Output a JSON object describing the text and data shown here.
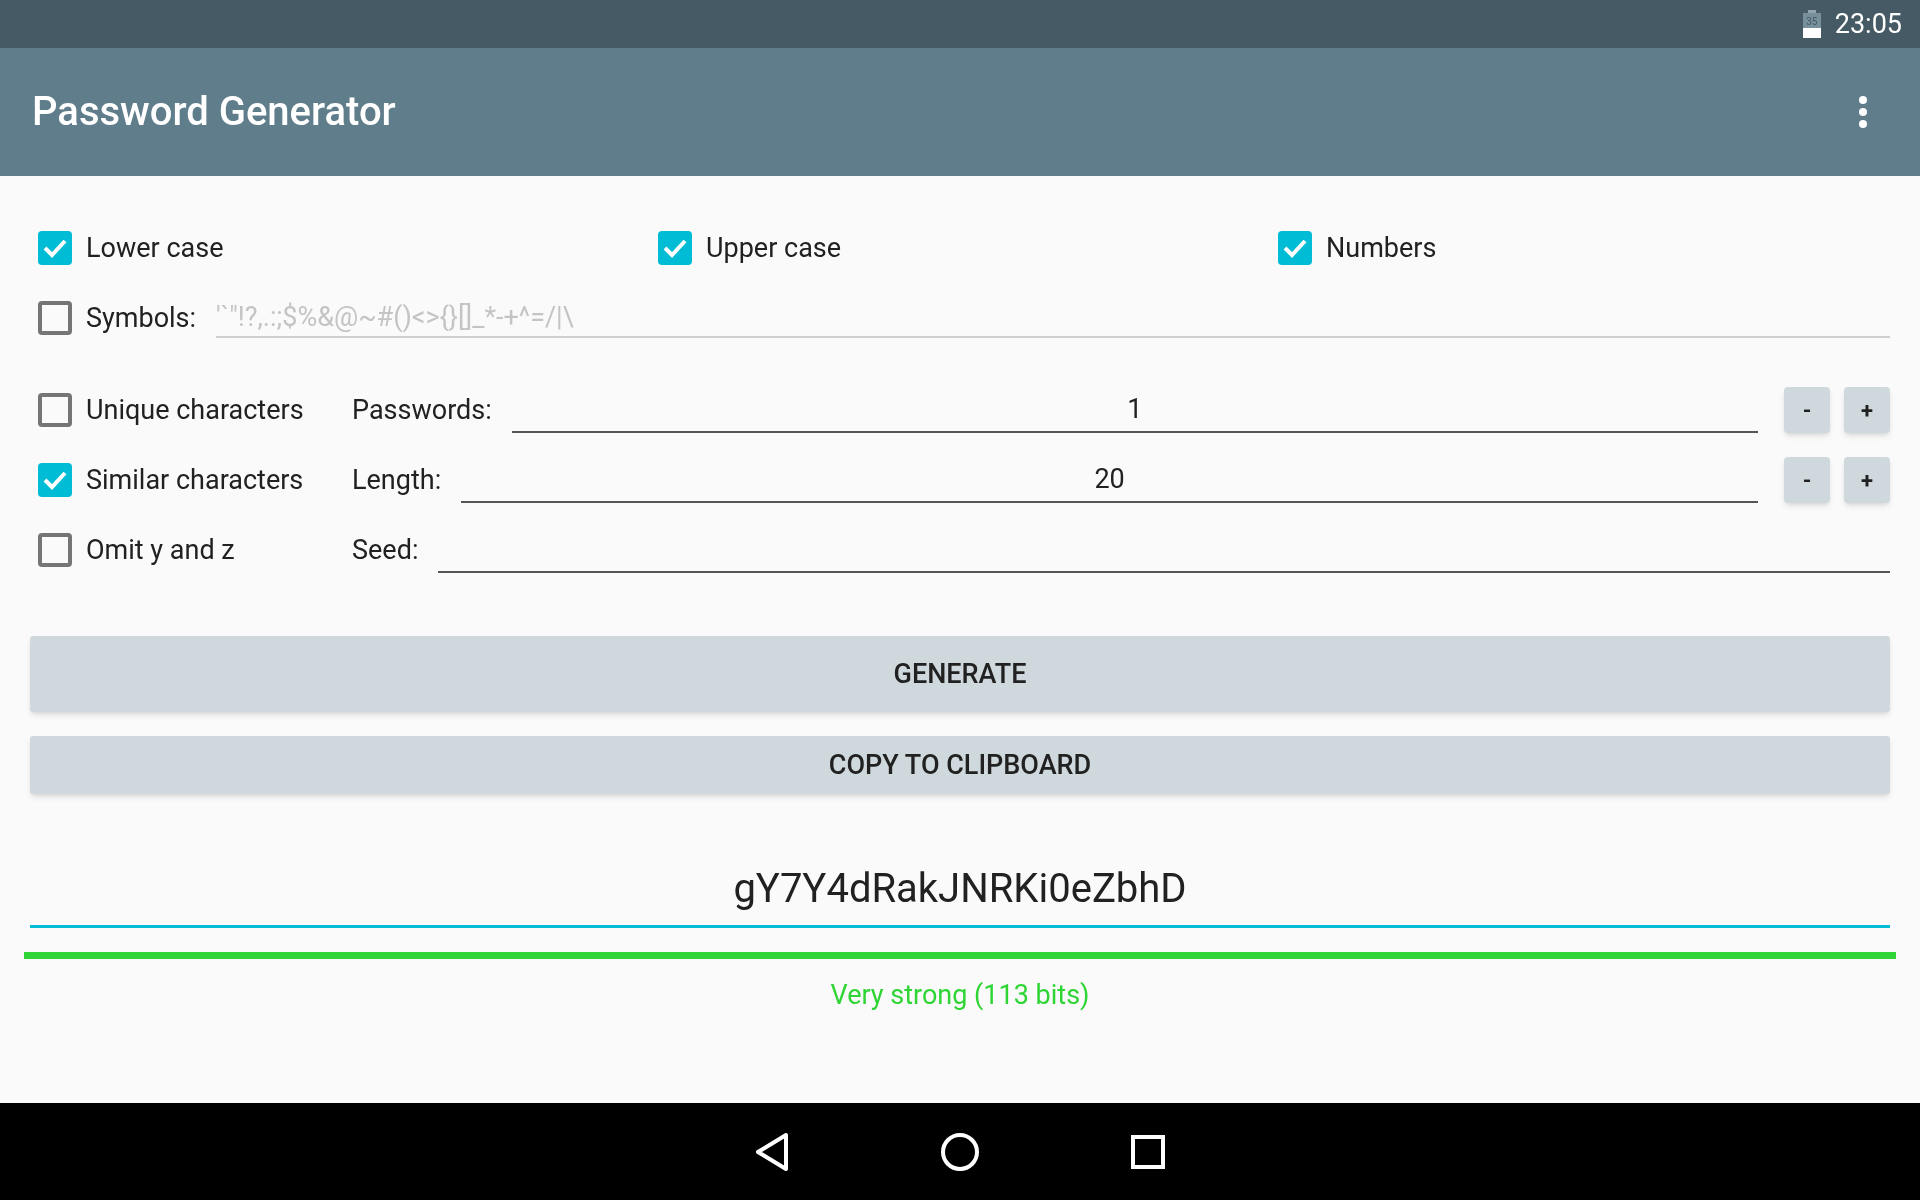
{
  "status_bar": {
    "battery": "35",
    "time": "23:05"
  },
  "app_bar": {
    "title": "Password Generator"
  },
  "char_options": [
    {
      "label": "Lower case",
      "checked": true
    },
    {
      "label": "Upper case",
      "checked": true
    },
    {
      "label": "Numbers",
      "checked": true
    }
  ],
  "symbols": {
    "label": "Symbols:",
    "checked": false,
    "placeholder": "'`\"!?,.:;$%&@~#()<>{}[]_*-+^=/|\\"
  },
  "option_rows": [
    {
      "label": "Unique characters",
      "checked": false,
      "field_label": "Passwords:",
      "value": "1",
      "kind": "stepper",
      "minus": "-",
      "plus": "+"
    },
    {
      "label": "Similar characters",
      "checked": true,
      "field_label": "Length:",
      "value": "20",
      "kind": "stepper",
      "minus": "-",
      "plus": "+"
    },
    {
      "label": "Omit y and z",
      "checked": false,
      "field_label": "Seed:",
      "kind": "text"
    }
  ],
  "buttons": [
    "GENERATE",
    "COPY TO CLIPBOARD"
  ],
  "password": "gY7Y4dRakJNRKi0eZbhD",
  "strength": {
    "level": 1,
    "label": "Very strong (113 bits)"
  }
}
